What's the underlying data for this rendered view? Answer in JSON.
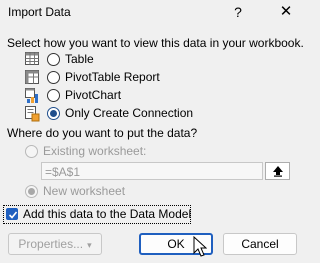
{
  "window": {
    "title": "Import Data",
    "help": "?",
    "close": "✕"
  },
  "view_section": {
    "heading": "Select how you want to view this data in your workbook.",
    "options": [
      {
        "label": "Table",
        "icon": "table-icon",
        "selected": false
      },
      {
        "label": "PivotTable Report",
        "icon": "pivottable-icon",
        "selected": false
      },
      {
        "label": "PivotChart",
        "icon": "pivotchart-icon",
        "selected": false
      },
      {
        "label": "Only Create Connection",
        "icon": "connection-icon",
        "selected": true
      }
    ]
  },
  "put_section": {
    "heading": "Where do you want to put the data?",
    "existing_label": "Existing worksheet:",
    "cell_value": "=$A$1",
    "new_label": "New worksheet"
  },
  "data_model": {
    "label": "Add this data to the Data Model",
    "checked": true
  },
  "buttons": {
    "properties": "Properties...",
    "ok": "OK",
    "cancel": "Cancel"
  },
  "colors": {
    "accent": "#1f5fbf",
    "background": "#f0f0f0",
    "disabled": "#9a9a9a"
  }
}
